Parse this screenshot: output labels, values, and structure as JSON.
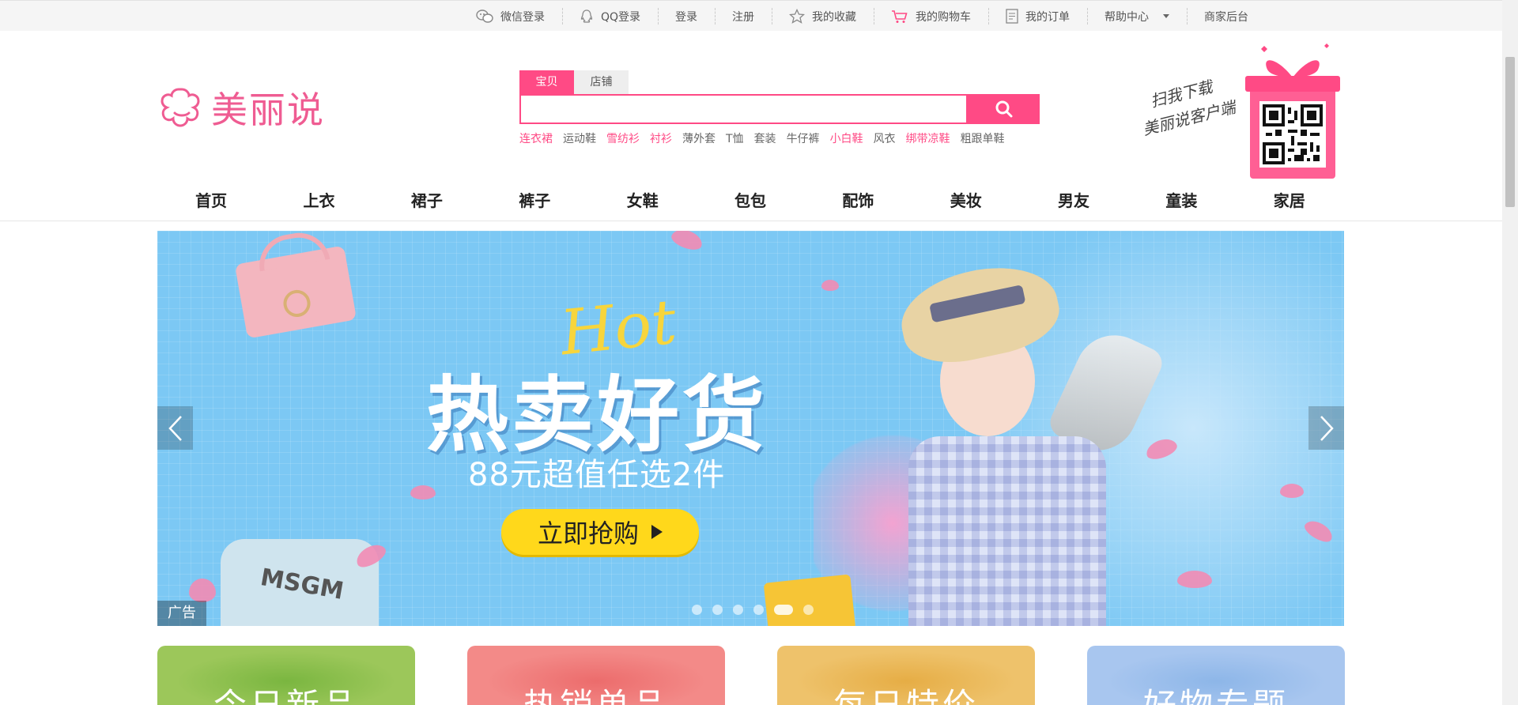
{
  "topbar": {
    "links": [
      {
        "label": "微信登录",
        "icon": "wechat-icon"
      },
      {
        "label": "QQ登录",
        "icon": "qq-icon"
      },
      {
        "label": "登录"
      },
      {
        "label": "注册"
      },
      {
        "label": "我的收藏",
        "icon": "star-icon"
      },
      {
        "label": "我的购物车",
        "icon": "cart-icon"
      },
      {
        "label": "我的订单",
        "icon": "order-icon"
      },
      {
        "label": "帮助中心",
        "icon": "chevron-down-icon"
      },
      {
        "label": "商家后台"
      }
    ]
  },
  "logo": {
    "text": "美丽说"
  },
  "search": {
    "tabs": [
      "宝贝",
      "店铺"
    ],
    "active_tab": "宝贝",
    "value": "",
    "placeholder": "",
    "hot_keywords": [
      {
        "label": "连衣裙",
        "highlight": true
      },
      {
        "label": "运动鞋",
        "highlight": false
      },
      {
        "label": "雪纺衫",
        "highlight": true
      },
      {
        "label": "衬衫",
        "highlight": true
      },
      {
        "label": "薄外套",
        "highlight": false
      },
      {
        "label": "T恤",
        "highlight": false
      },
      {
        "label": "套装",
        "highlight": false
      },
      {
        "label": "牛仔裤",
        "highlight": false
      },
      {
        "label": "小白鞋",
        "highlight": true
      },
      {
        "label": "风衣",
        "highlight": false
      },
      {
        "label": "绑带凉鞋",
        "highlight": true
      },
      {
        "label": "粗跟单鞋",
        "highlight": false
      }
    ]
  },
  "qr": {
    "line1": "扫我下载",
    "line2": "美丽说客户端"
  },
  "nav": [
    "首页",
    "上衣",
    "裙子",
    "裤子",
    "女鞋",
    "包包",
    "配饰",
    "美妆",
    "男友",
    "童装",
    "家居"
  ],
  "banner": {
    "script": "Hot",
    "headline": "热卖好货",
    "subline": "88元超值任选2件",
    "cta": "立即抢购",
    "ad_tag": "广告",
    "tee_text": "MSGM",
    "slide_count": 6,
    "active_slide": 5
  },
  "cards": [
    "今日新品",
    "热销单品",
    "每日特价",
    "好物专题"
  ],
  "colors": {
    "brand": "#ff4a85",
    "logo": "#ef5c92",
    "cta": "#ffd81b",
    "banner_bg": "#7cc8f4"
  }
}
